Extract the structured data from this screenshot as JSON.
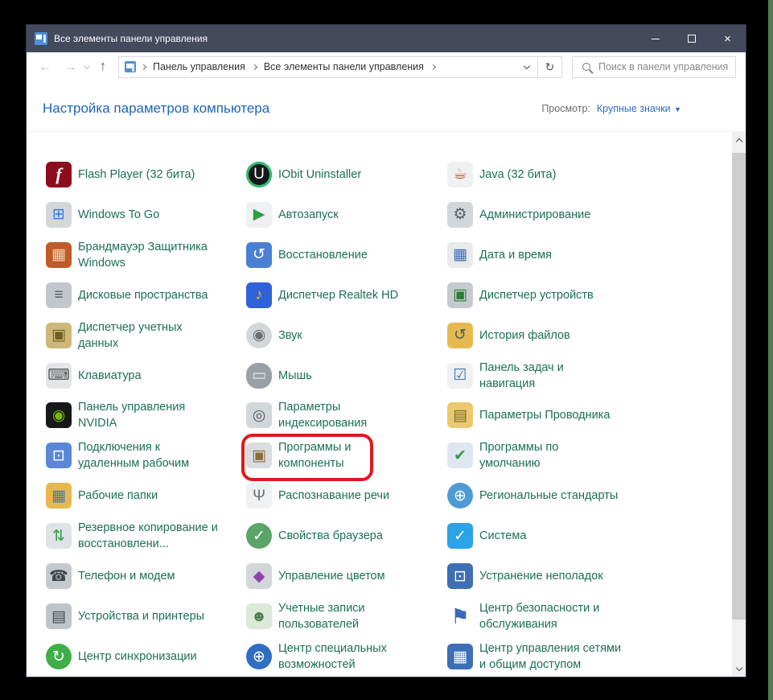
{
  "window": {
    "title": "Все элементы панели управления"
  },
  "chrome": {
    "back": "←",
    "forward": "→",
    "refresh": "↻",
    "up": "↑"
  },
  "address_bar": {
    "breadcrumb": [
      "Панель управления",
      "Все элементы панели управления"
    ],
    "search_placeholder": "Поиск в панели управления"
  },
  "header": {
    "title": "Настройка параметров компьютера",
    "view_label": "Просмотр:",
    "view_value": "Крупные значки"
  },
  "colors": {
    "titlebar": "#444a5b",
    "item_text": "#1b7050",
    "header_blue": "#1d65b8",
    "highlight_red": "#e0191f"
  },
  "columns": [
    {
      "items": [
        {
          "label": "Flash Player (32 бита)",
          "icon": {
            "name": "flash-player-icon",
            "glyph": "f",
            "bg": "#8d0d1e",
            "fg": "#ffffff",
            "cls": "serif"
          }
        },
        {
          "label": "Windows To Go",
          "icon": {
            "name": "windows-to-go-icon",
            "glyph": "⊞",
            "bg": "#d3d7da",
            "fg": "#2f7de1"
          }
        },
        {
          "label": "Брандмауэр Защитника\nWindows",
          "icon": {
            "name": "windows-firewall-icon",
            "glyph": "▦",
            "bg": "#bf5b28",
            "fg": "#f3d1b0"
          }
        },
        {
          "label": "Дисковые пространства",
          "icon": {
            "name": "storage-spaces-icon",
            "glyph": "≡",
            "bg": "#c3c7cb",
            "fg": "#565b60"
          }
        },
        {
          "label": "Диспетчер учетных\nданных",
          "icon": {
            "name": "credential-manager-icon",
            "glyph": "▣",
            "bg": "#cdb878",
            "fg": "#6f5e23"
          }
        },
        {
          "label": "Клавиатура",
          "icon": {
            "name": "keyboard-icon",
            "glyph": "⌨",
            "bg": "#e3e5e7",
            "fg": "#555555"
          }
        },
        {
          "label": "Панель управления\nNVIDIA",
          "icon": {
            "name": "nvidia-control-panel-icon",
            "glyph": "◉",
            "bg": "#17181a",
            "fg": "#76b900"
          }
        },
        {
          "label": "Подключения к\nудаленным рабочим",
          "icon": {
            "name": "remote-desktop-icon",
            "glyph": "⊡",
            "bg": "#5b87d6",
            "fg": "#ffffff"
          }
        },
        {
          "label": "Рабочие папки",
          "icon": {
            "name": "work-folders-icon",
            "glyph": "▦",
            "bg": "#e6b94f",
            "fg": "#3e78c9"
          }
        },
        {
          "label": "Резервное копирование и\nвосстановлени...",
          "icon": {
            "name": "backup-restore-icon",
            "glyph": "⇅",
            "bg": "#dfe3e6",
            "fg": "#2e9e44"
          }
        },
        {
          "label": "Телефон и модем",
          "icon": {
            "name": "phone-modem-icon",
            "glyph": "☎",
            "bg": "#c6cacf",
            "fg": "#3f4449"
          }
        },
        {
          "label": "Устройства и принтеры",
          "icon": {
            "name": "devices-printers-icon",
            "glyph": "▤",
            "bg": "#bfc4c9",
            "fg": "#43484d"
          }
        },
        {
          "label": "Центр синхронизации",
          "icon": {
            "name": "sync-center-icon",
            "glyph": "↻",
            "bg": "#3fae49",
            "fg": "#ffffff",
            "shape": "circle"
          }
        }
      ]
    },
    {
      "items": [
        {
          "label": "IObit Uninstaller",
          "icon": {
            "name": "iobit-uninstaller-icon",
            "glyph": "U",
            "bg": "#14181c",
            "fg": "#ffffff",
            "shape": "circle",
            "ring": "#2fbf71"
          }
        },
        {
          "label": "Автозапуск",
          "icon": {
            "name": "autorun-icon",
            "glyph": "▶",
            "bg": "#eef0f2",
            "fg": "#2e9e44"
          }
        },
        {
          "label": "Восстановление",
          "icon": {
            "name": "recovery-icon",
            "glyph": "↺",
            "bg": "#4a80d4",
            "fg": "#ffffff"
          }
        },
        {
          "label": "Диспетчер Realtek HD",
          "icon": {
            "name": "realtek-hd-icon",
            "glyph": "♪",
            "bg": "#2f62d9",
            "fg": "#f4b400"
          }
        },
        {
          "label": "Звук",
          "icon": {
            "name": "sound-icon",
            "glyph": "◉",
            "bg": "#d4d7da",
            "fg": "#6a6f74",
            "shape": "circle"
          }
        },
        {
          "label": "Мышь",
          "icon": {
            "name": "mouse-icon",
            "glyph": "▭",
            "bg": "#9aa0a6",
            "fg": "#e8eaed",
            "shape": "pill"
          }
        },
        {
          "label": "Параметры\nиндексирования",
          "icon": {
            "name": "indexing-options-icon",
            "glyph": "◎",
            "bg": "#d4d7da",
            "fg": "#565b60"
          }
        },
        {
          "label": "Программы и\nкомпоненты",
          "highlighted": true,
          "icon": {
            "name": "programs-and-features-icon",
            "glyph": "▣",
            "bg": "#d9dde0",
            "fg": "#8a6d3b"
          }
        },
        {
          "label": "Распознавание речи",
          "icon": {
            "name": "speech-recognition-icon",
            "glyph": "Ψ",
            "bg": "#eef0f2",
            "fg": "#6a6f75"
          }
        },
        {
          "label": "Свойства браузера",
          "icon": {
            "name": "internet-options-icon",
            "glyph": "✓",
            "bg": "#5aa469",
            "fg": "#ffffff",
            "shape": "circle"
          }
        },
        {
          "label": "Управление цветом",
          "icon": {
            "name": "color-management-icon",
            "glyph": "◆",
            "bg": "#d4d7da",
            "fg": "#8e44ad"
          }
        },
        {
          "label": "Учетные записи\nпользователей",
          "icon": {
            "name": "user-accounts-icon",
            "glyph": "☻",
            "bg": "#dce8d8",
            "fg": "#4f7d4f"
          }
        },
        {
          "label": "Центр специальных\nвозможностей",
          "icon": {
            "name": "ease-of-access-icon",
            "glyph": "⊕",
            "bg": "#2f6fc2",
            "fg": "#ffffff",
            "shape": "circle"
          }
        }
      ]
    },
    {
      "items": [
        {
          "label": "Java (32 бита)",
          "icon": {
            "name": "java-icon",
            "glyph": "☕",
            "bg": "#eef0f2",
            "fg": "#b5541f"
          }
        },
        {
          "label": "Администрирование",
          "icon": {
            "name": "administrative-tools-icon",
            "glyph": "⚙",
            "bg": "#d4d7da",
            "fg": "#565b60"
          }
        },
        {
          "label": "Дата и время",
          "icon": {
            "name": "date-time-icon",
            "glyph": "▦",
            "bg": "#e8eaec",
            "fg": "#3d6fb4"
          }
        },
        {
          "label": "Диспетчер устройств",
          "icon": {
            "name": "device-manager-icon",
            "glyph": "▣",
            "bg": "#c6cacf",
            "fg": "#2e7d32"
          }
        },
        {
          "label": "История файлов",
          "icon": {
            "name": "file-history-icon",
            "glyph": "↺",
            "bg": "#e6b94f",
            "fg": "#565b60"
          }
        },
        {
          "label": "Панель задач и\nнавигация",
          "icon": {
            "name": "taskbar-navigation-icon",
            "glyph": "☑",
            "bg": "#eef0f2",
            "fg": "#3d6fb4"
          }
        },
        {
          "label": "Параметры Проводника",
          "icon": {
            "name": "explorer-options-icon",
            "glyph": "▤",
            "bg": "#ecc96e",
            "fg": "#7a6a2f"
          }
        },
        {
          "label": "Программы по\nумолчанию",
          "icon": {
            "name": "default-programs-icon",
            "glyph": "✔",
            "bg": "#dfe6f2",
            "fg": "#2e9e44"
          }
        },
        {
          "label": "Региональные стандарты",
          "icon": {
            "name": "region-icon",
            "glyph": "⊕",
            "bg": "#4d9bd6",
            "fg": "#ffffff",
            "shape": "circle"
          }
        },
        {
          "label": "Система",
          "icon": {
            "name": "system-icon",
            "glyph": "✓",
            "bg": "#2aa3e8",
            "fg": "#ffffff"
          }
        },
        {
          "label": "Устранение неполадок",
          "icon": {
            "name": "troubleshooting-icon",
            "glyph": "⊡",
            "bg": "#3d6fb4",
            "fg": "#ffffff"
          }
        },
        {
          "label": "Центр безопасности и\nобслуживания",
          "icon": {
            "name": "security-maintenance-icon",
            "glyph": "⚑",
            "bg": "transparent",
            "fg": "#3b67b8",
            "cls": "big"
          }
        },
        {
          "label": "Центр управления сетями\nи общим доступом",
          "icon": {
            "name": "network-sharing-center-icon",
            "glyph": "▦",
            "bg": "#3d6fb4",
            "fg": "#ffffff"
          }
        }
      ]
    }
  ]
}
